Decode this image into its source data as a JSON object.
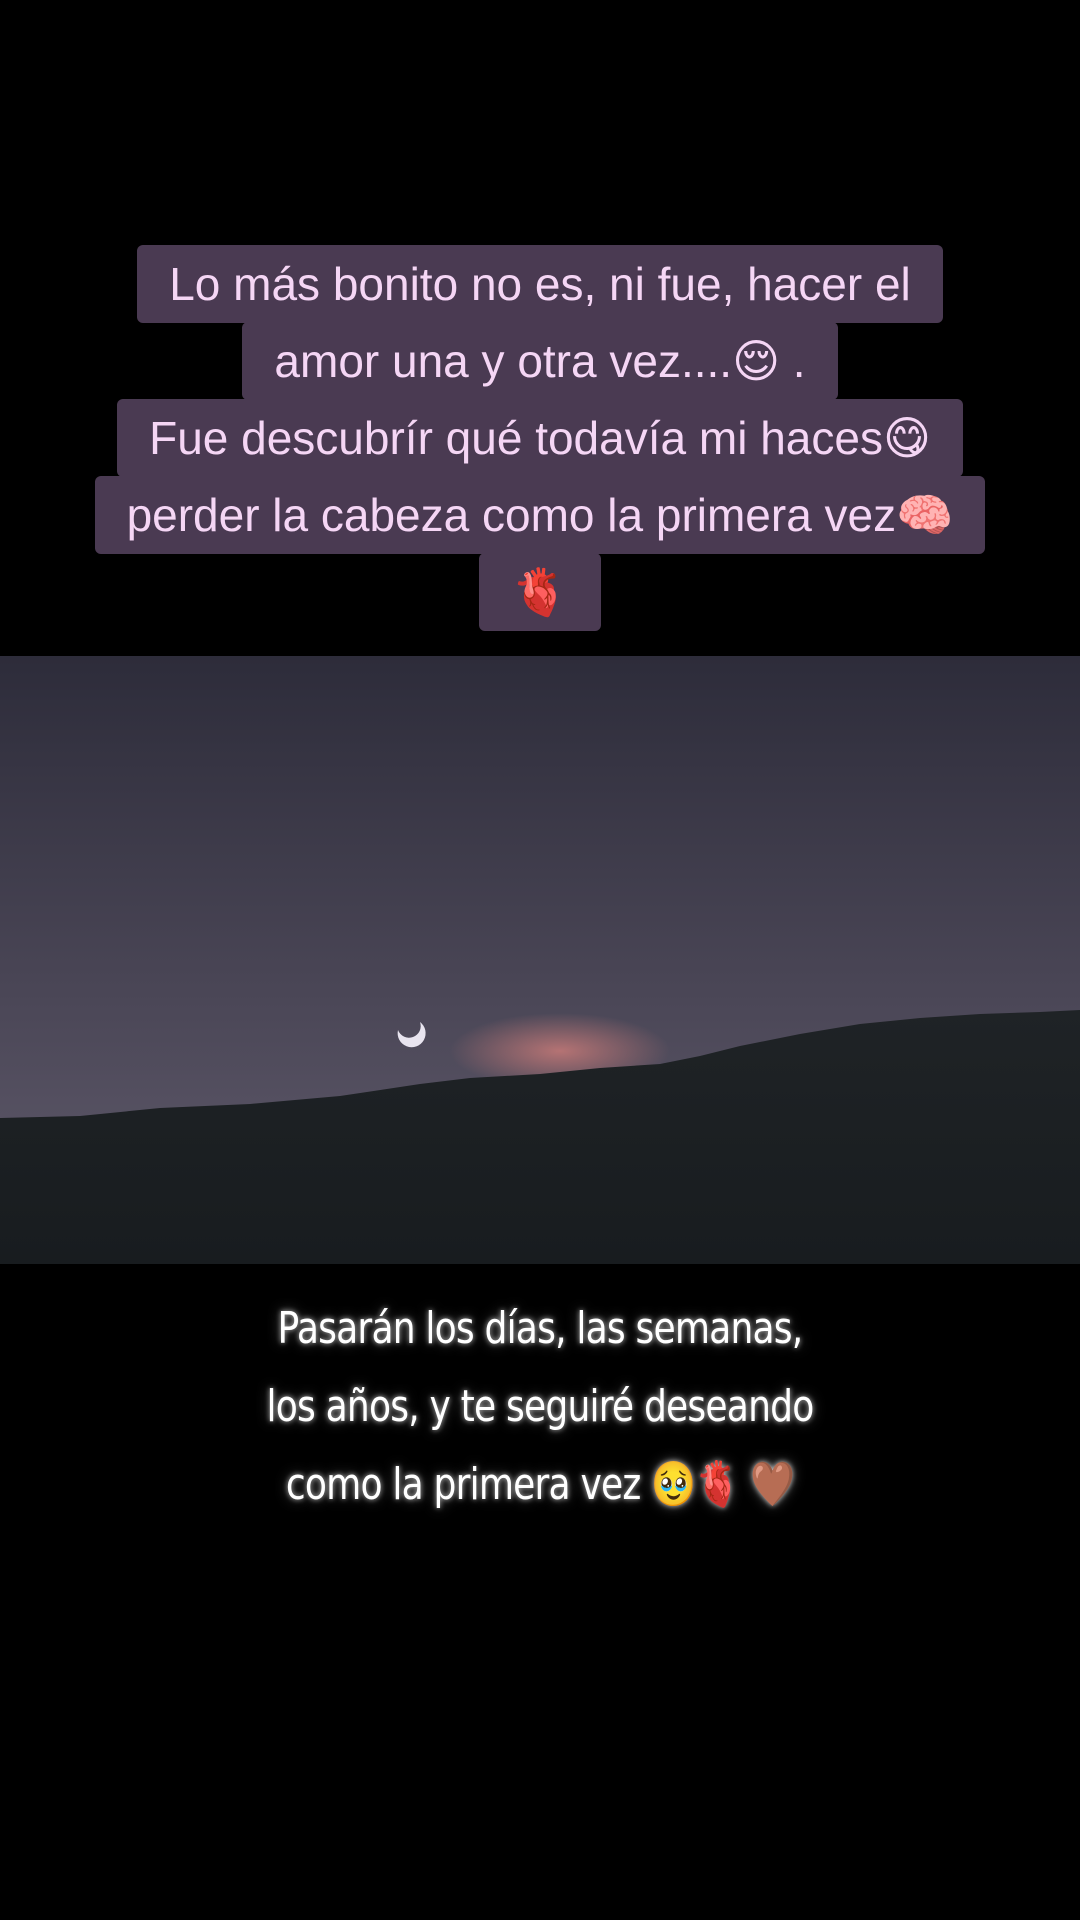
{
  "overlay_top": {
    "lines": [
      "Lo más bonito no es, ni fue, hacer el",
      "amor una y otra  vez....😌 .",
      "Fue descubrír qué  todavía mi haces😋",
      "perder la cabeza como la primera vez🧠",
      "🫀"
    ],
    "bg_color": "#4a3a52",
    "text_color": "#f5d6f5"
  },
  "photo": {
    "sky_colors": [
      "#2d2c3a",
      "#4a4656",
      "#5a5566"
    ],
    "hill_color": "#1c2124",
    "glow_color": "#c77a78"
  },
  "overlay_bottom": {
    "lines": [
      "Pasarán   los  días, las semanas,",
      "los años, y te seguiré deseando",
      "como la primera vez 🥹🫀 🤎"
    ],
    "text_color": "#ffffff"
  }
}
